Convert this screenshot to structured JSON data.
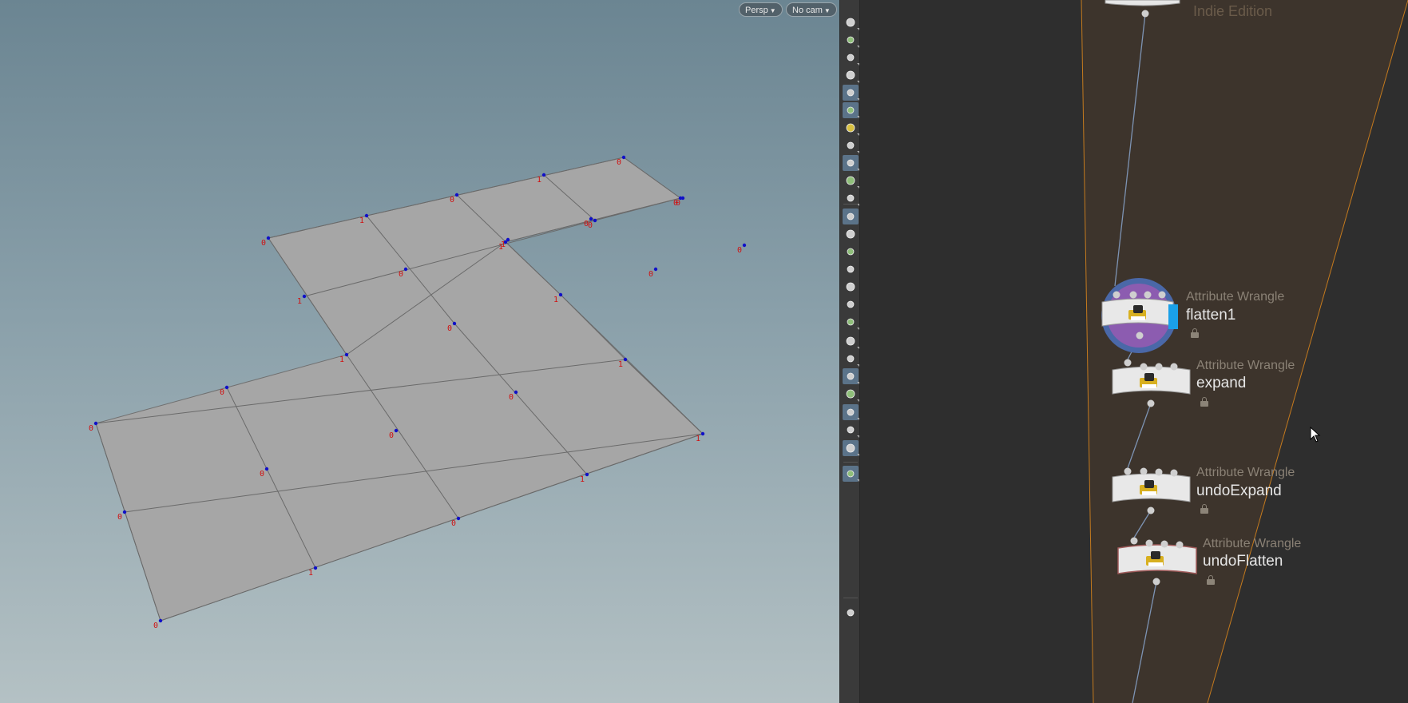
{
  "viewport": {
    "persp_label": "Persp",
    "cam_label": "No cam",
    "point_labels": [
      "0",
      "1",
      "0",
      "1",
      "0",
      "1",
      "0",
      "1",
      "0",
      "0",
      "1",
      "0",
      "1",
      "0",
      "0",
      "0",
      "0",
      "1",
      "0",
      "0",
      "0",
      "0",
      "1",
      "0",
      "1",
      "0",
      "1",
      "0",
      "1",
      "0"
    ]
  },
  "toolbar": {
    "icons": [
      "visibility-icon",
      "display-options-icon",
      "lock-icon",
      "xray-icon",
      "shading-icon",
      "light-icon",
      "headlight-icon",
      "skeleton-icon",
      "render-display-icon",
      "camera-icon",
      "camera-link-icon",
      "point-display-icon",
      "normal-display-icon",
      "edge-display-icon",
      "point-number-icon",
      "primitive-display-icon",
      "primitive-number-icon",
      "uv-icon",
      "brush-icon",
      "texture-icon",
      "snapping-icon",
      "geometry-icon",
      "select-icon",
      "persist-icon",
      "background-icon",
      "pin-icon",
      "info-icon"
    ]
  },
  "network": {
    "watermark": "Indie Edition",
    "nodes": [
      {
        "type": "Attribute Wrangle",
        "name": "flatten1"
      },
      {
        "type": "Attribute Wrangle",
        "name": "expand"
      },
      {
        "type": "Attribute Wrangle",
        "name": "undoExpand"
      },
      {
        "type": "Attribute Wrangle",
        "name": "undoFlatten"
      }
    ]
  },
  "colors": {
    "grid_fill": "#a6a6a6",
    "point_color": "#1010c8",
    "label_color": "#d01010",
    "network_box": "#3d342c",
    "network_border": "#c47a1e",
    "selected_ring": "#4a68a8",
    "selected_fill": "#8c5cb0"
  }
}
